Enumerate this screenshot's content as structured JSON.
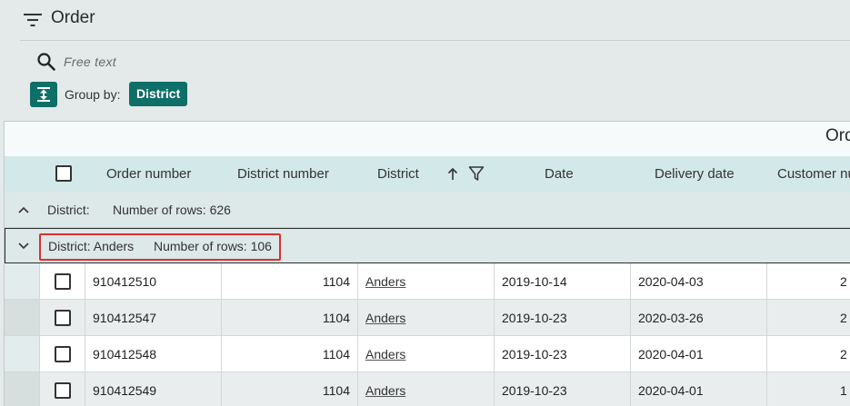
{
  "header": {
    "title": "Order"
  },
  "search": {
    "placeholder": "Free text",
    "value": ""
  },
  "grouping": {
    "label": "Group by:",
    "chip": "District"
  },
  "grid": {
    "title": "Ord",
    "columns": [
      "Order number",
      "District number",
      "District",
      "Date",
      "Delivery date",
      "Customer nu"
    ],
    "groups": [
      {
        "label": "District:",
        "count_label": "Number of rows: 626"
      },
      {
        "label": "District: Anders",
        "count_label": "Number of rows: 106"
      }
    ],
    "rows": [
      {
        "order": "910412510",
        "district_no": "1104",
        "district": "Anders",
        "date": "2019-10-14",
        "delivery": "2020-04-03",
        "customer": "2"
      },
      {
        "order": "910412547",
        "district_no": "1104",
        "district": "Anders",
        "date": "2019-10-23",
        "delivery": "2020-03-26",
        "customer": "2"
      },
      {
        "order": "910412548",
        "district_no": "1104",
        "district": "Anders",
        "date": "2019-10-23",
        "delivery": "2020-04-01",
        "customer": "2"
      },
      {
        "order": "910412549",
        "district_no": "1104",
        "district": "Anders",
        "date": "2019-10-23",
        "delivery": "2020-04-01",
        "customer": "1"
      }
    ]
  },
  "colors": {
    "accent": "#0e6f68",
    "header_bg": "#d3e8e8",
    "highlight": "#d93030"
  }
}
